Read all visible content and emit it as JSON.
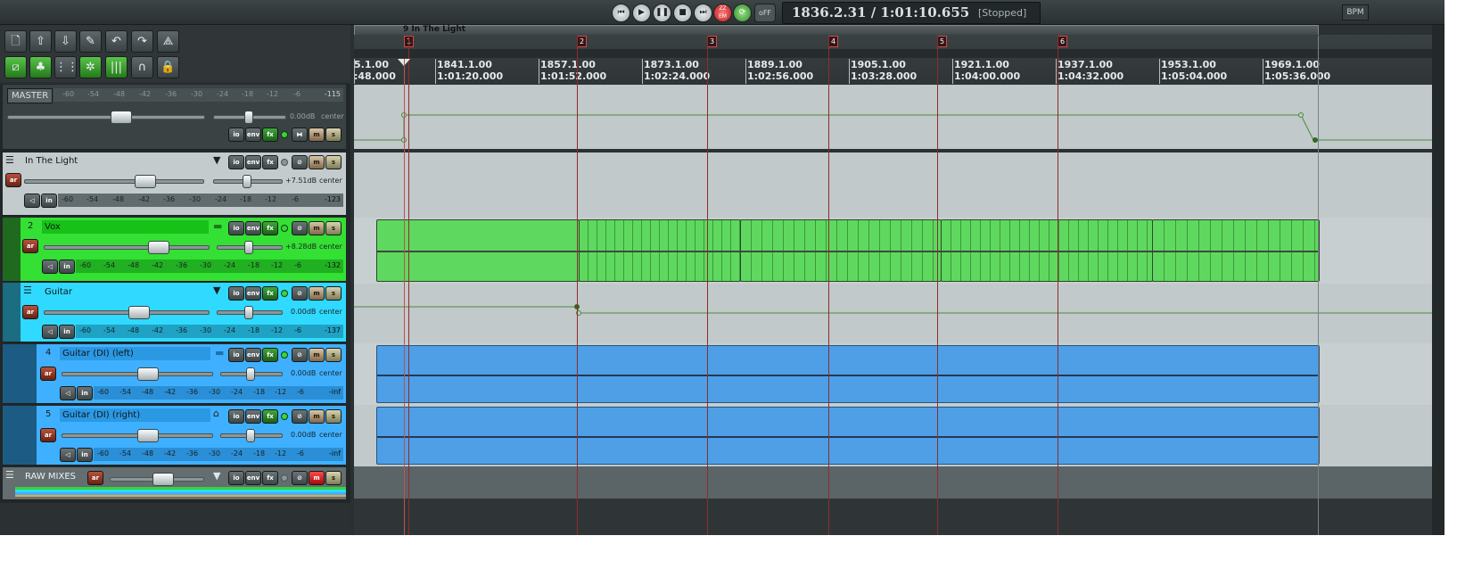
{
  "transport": {
    "time_display": "1836.2.31 / 1:01:10.655",
    "state": "[Stopped]",
    "off_label": "oFF",
    "bpm_label": "BPM",
    "buttons": [
      "skip-start",
      "play",
      "pause",
      "stop",
      "skip-end",
      "record",
      "repeat"
    ]
  },
  "toolbar": {
    "icons": [
      "new-project-icon",
      "open-project-icon",
      "save-project-icon",
      "settings-wrench-icon",
      "undo-icon",
      "redo-icon",
      "metronome-icon",
      "envelope-toggle-icon",
      "ripple-editing-icon",
      "grid-icon",
      "snap-icon",
      "track-grouping-icon",
      "loop-icon",
      "lock-icon"
    ]
  },
  "master": {
    "label": "MASTER",
    "scale": [
      "-60",
      "-54",
      "-48",
      "-42",
      "-36",
      "-30",
      "-24",
      "-18",
      "-12",
      "-6"
    ],
    "peak": "-115",
    "volume": "0.00dB",
    "pan": "center",
    "volume_fraction": 0.58,
    "pan_fraction": 0.5,
    "buttons": [
      "io",
      "env",
      "fx",
      "m",
      "s"
    ]
  },
  "tracks": [
    {
      "id": "folder",
      "name": "In The Light",
      "number": "",
      "volume": "+7.51dB",
      "pan": "center",
      "peak": "-123",
      "volume_fraction": 0.68,
      "pan_fraction": 0.5
    },
    {
      "id": "vox",
      "name": "Vox",
      "number": "2",
      "volume": "+8.28dB",
      "pan": "center",
      "peak": "-132",
      "volume_fraction": 0.7,
      "pan_fraction": 0.5
    },
    {
      "id": "guitar",
      "name": "Guitar",
      "number": "",
      "volume": "0.00dB",
      "pan": "center",
      "peak": "-137",
      "volume_fraction": 0.58,
      "pan_fraction": 0.5
    },
    {
      "id": "guitar-di-left",
      "name": "Guitar (DI) (left)",
      "number": "4",
      "volume": "0.00dB",
      "pan": "center",
      "peak": "-inf",
      "volume_fraction": 0.58,
      "pan_fraction": 0.5
    },
    {
      "id": "guitar-di-right",
      "name": "Guitar (DI) (right)",
      "number": "5",
      "volume": "0.00dB",
      "pan": "center",
      "peak": "-inf",
      "volume_fraction": 0.58,
      "pan_fraction": 0.5
    }
  ],
  "raw_mixes": {
    "name": "RAW MIXES",
    "buttons": [
      "ar",
      "io",
      "env",
      "fx",
      "m",
      "s"
    ]
  },
  "button_labels": {
    "io": "io",
    "env": "env",
    "fx": "fx",
    "m": "m",
    "s": "s",
    "ar": "ar",
    "in": "in"
  },
  "meter_scale": [
    "-60",
    "-54",
    "-48",
    "-42",
    "-36",
    "-30",
    "-24",
    "-18",
    "-12",
    "-6"
  ],
  "timeline": {
    "region_label": "9  In The Light",
    "markers": [
      "1",
      "2",
      "3",
      "4",
      "5",
      "6"
    ],
    "bars": [
      {
        "bar": "5.1.00",
        "time": ":48.000"
      },
      {
        "bar": "1841.1.00",
        "time": "1:01:20.000"
      },
      {
        "bar": "1857.1.00",
        "time": "1:01:52.000"
      },
      {
        "bar": "1873.1.00",
        "time": "1:02:24.000"
      },
      {
        "bar": "1889.1.00",
        "time": "1:02:56.000"
      },
      {
        "bar": "1905.1.00",
        "time": "1:03:28.000"
      },
      {
        "bar": "1921.1.00",
        "time": "1:04:00.000"
      },
      {
        "bar": "1937.1.00",
        "time": "1:04:32.000"
      },
      {
        "bar": "1953.1.00",
        "time": "1:05:04.000"
      },
      {
        "bar": "1969.1.00",
        "time": "1:05:36.000"
      }
    ]
  },
  "colors": {
    "vox_track": "#33e033",
    "vox_item": "#5fd85f",
    "guitar_track": "#2fd9ff",
    "guitar_di_track": "#3fb0ff",
    "guitar_di_item": "#4e9fe6",
    "folder_track": "#c4cbcd",
    "marker": "#c23434"
  }
}
